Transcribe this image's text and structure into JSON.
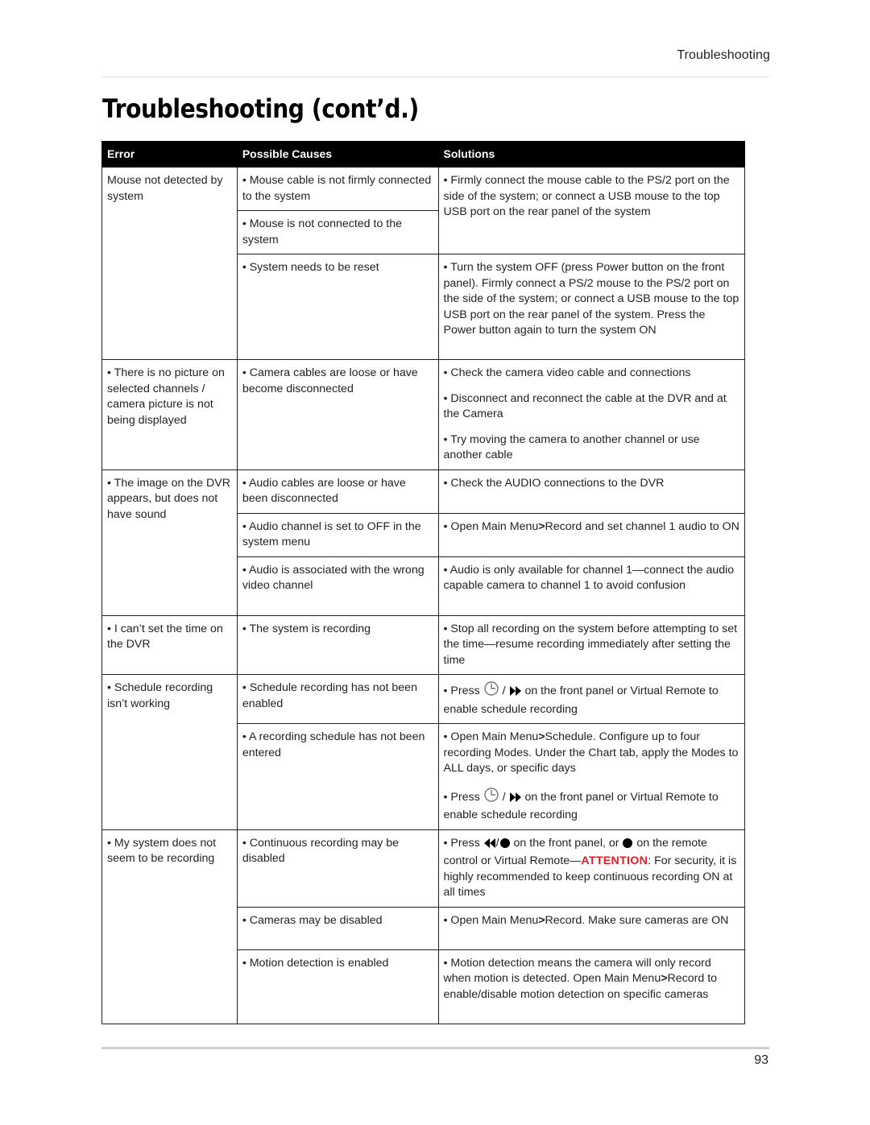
{
  "running_head": "Troubleshooting",
  "title": "Troubleshooting (cont’d.)",
  "table": {
    "headers": [
      "Error",
      "Possible Causes",
      "Solutions"
    ],
    "groups": [
      {
        "error": "Mouse not detected by system",
        "rows": [
          {
            "cause": "• Mouse cable is not firmly connected to the system",
            "solutions": [
              "• Firmly connect the mouse cable to the PS/2 port on the side of the system; or connect a USB mouse to the top USB port on the rear panel of the system"
            ]
          },
          {
            "cause": "• Mouse is not connected to the system"
          },
          {
            "cause": "• System needs to be reset",
            "solutions": [
              "• Turn the system OFF (press Power button on the front panel). Firmly connect a PS/2 mouse to the PS/2 port on the side of the system; or connect a USB mouse to the top USB port on the rear panel of the system. Press the Power button again to turn the system ON"
            ]
          }
        ]
      },
      {
        "error": "• There is no picture on selected channels / camera picture is not being displayed",
        "rows": [
          {
            "cause": "• Camera cables are loose or have become disconnected",
            "solutions": [
              "• Check the camera video cable and connections",
              "• Disconnect and reconnect the cable at the DVR and at the Camera",
              "• Try moving the camera to another channel or use another cable"
            ]
          }
        ]
      },
      {
        "error": "• The image on the DVR appears, but does not have sound",
        "rows": [
          {
            "cause": "• Audio cables are loose or have been disconnected",
            "solutions": [
              "• Check the AUDIO connections to the DVR"
            ]
          },
          {
            "cause": "• Audio channel is set to OFF in the system menu",
            "solutions_parts": {
              "a": "• Open Main Menu",
              "b": "Record and set channel 1 audio to ON"
            }
          },
          {
            "cause": "• Audio is associated with the wrong video channel",
            "solutions": [
              "• Audio is only available for channel 1—connect the audio capable camera to channel 1 to avoid confusion"
            ]
          }
        ]
      },
      {
        "error": "• I can’t set the time on the DVR",
        "rows": [
          {
            "cause": "• The system is recording",
            "solutions": [
              "• Stop all recording on the system before attempting to set the time—resume recording immediately after setting the time"
            ]
          }
        ]
      },
      {
        "error": "• Schedule recording isn’t working",
        "rows": [
          {
            "cause": "• Schedule recording has not been enabled",
            "press": "• Press",
            "slash": "/",
            "after": "on the front panel or Virtual Remote to enable schedule recording"
          },
          {
            "cause": "• A recording schedule has not been entered",
            "sol1_a": "• Open Main Menu",
            "sol1_b": "Schedule. Configure up to four recording Modes. Under the Chart tab, apply the Modes to ALL days, or specific days",
            "press": "• Press",
            "slash": "/",
            "after": "on the front panel or Virtual Remote to enable schedule recording"
          }
        ]
      },
      {
        "error": "• My system does not seem to be recording",
        "rows": [
          {
            "cause": "• Continuous recording may be disabled",
            "press": "• Press",
            "slash": "/",
            "mid": "on the front panel, or",
            "mid2": "on the remote control or Virtual Remote—",
            "attention": "ATTENTION",
            "after": ": For security, it is highly recommended to keep continuous recording ON at all times"
          },
          {
            "cause": "• Cameras may be disabled",
            "a": "• Open Main Menu",
            "b": "Record. Make sure cameras are ON"
          },
          {
            "cause": "• Motion detection is enabled",
            "a": "• Motion detection means the camera will only record when motion is detected. Open Main Menu",
            "b": "Record to enable/disable motion detection on specific cameras"
          }
        ]
      }
    ]
  },
  "symbols": {
    "gt": ">"
  },
  "colors": {
    "header_bg": "#000000",
    "attention": "#e31b23",
    "rule": "#d9d9d9"
  },
  "page_number": "93"
}
